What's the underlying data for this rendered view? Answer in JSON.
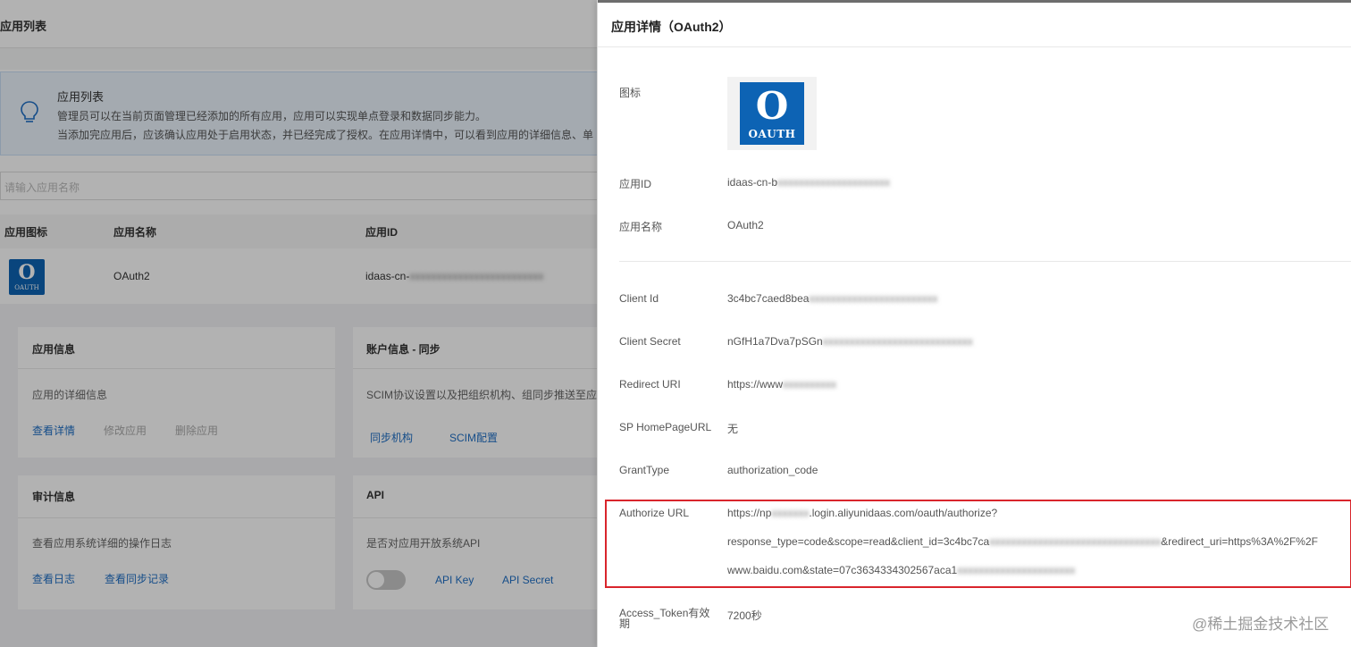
{
  "background": {
    "header_title": "应用列表",
    "tip": {
      "title": "应用列表",
      "line1": "管理员可以在当前页面管理已经添加的所有应用，应用可以实现单点登录和数据同步能力。",
      "line2": "当添加完应用后，应该确认应用处于启用状态，并已经完成了授权。在应用详情中，可以看到应用的详细信息、单"
    },
    "search_placeholder": "请输入应用名称",
    "table": {
      "headers": [
        "应用图标",
        "应用名称",
        "应用ID"
      ],
      "row": {
        "icon_text": "O",
        "icon_sub": "OAUTH",
        "name": "OAuth2",
        "app_id": "idaas-cn-"
      }
    },
    "cards": {
      "app_info": {
        "title": "应用信息",
        "desc": "应用的详细信息",
        "links": [
          "查看详情",
          "修改应用",
          "删除应用"
        ]
      },
      "account_sync": {
        "title": "账户信息 - 同步",
        "desc": "SCIM协议设置以及把组织机构、组同步推送至应",
        "links": [
          "同步机构",
          "SCIM配置"
        ]
      },
      "audit": {
        "title": "审计信息",
        "desc": "查看应用系统详细的操作日志",
        "links": [
          "查看日志",
          "查看同步记录"
        ]
      },
      "api": {
        "title": "API",
        "desc": "是否对应用开放系统API",
        "links": [
          "API Key",
          "API Secret"
        ],
        "enabled": false
      }
    }
  },
  "drawer": {
    "title": "应用详情（OAuth2）",
    "icon": {
      "label": "图标",
      "letter": "O",
      "sub": "OAUTH"
    },
    "fields": {
      "app_id": {
        "label": "应用ID",
        "value": "idaas-cn-b",
        "blurred": "xxxxxxxxxxxxxxxxxxxxx"
      },
      "app_name": {
        "label": "应用名称",
        "value": "OAuth2"
      },
      "client_id": {
        "label": "Client Id",
        "value": "3c4bc7caed8bea",
        "blurred": "xxxxxxxxxxxxxxxxxxxxxxxx"
      },
      "client_secret": {
        "label": "Client Secret",
        "value": "nGfH1a7Dva7pSGn",
        "blurred": "xxxxxxxxxxxxxxxxxxxxxxxxxxxx"
      },
      "redirect_uri": {
        "label": "Redirect URI",
        "value": "https://www",
        "blurred": "xxxxxxxxxx"
      },
      "sp_homepage": {
        "label": "SP HomePageURL",
        "value": "无"
      },
      "grant_type": {
        "label": "GrantType",
        "value": "authorization_code"
      },
      "authorize_url": {
        "label": "Authorize URL",
        "line1_a": "https://np",
        "line1_blur": "xxxxxxx",
        "line1_b": ".login.aliyunidaas.com/oauth/authorize?",
        "line2_a": "response_type=code&scope=read&client_id=3c4bc7ca",
        "line2_blur": "xxxxxxxxxxxxxxxxxxxxxxxxxxxxxxxx",
        "line2_b": "&redirect_uri=https%3A%2F%2F",
        "line3_a": "www.baidu.com&state=07c3634334302567aca1",
        "line3_blur": "xxxxxxxxxxxxxxxxxxxxxx"
      },
      "access_token": {
        "label": "Access_Token有效期",
        "value": "7200秒"
      }
    },
    "highlight_color": "#d9252c"
  },
  "watermark": "@稀土掘金技术社区",
  "colors": {
    "accent": "#1f6fc5",
    "oauth_blue": "#0d63b4"
  }
}
